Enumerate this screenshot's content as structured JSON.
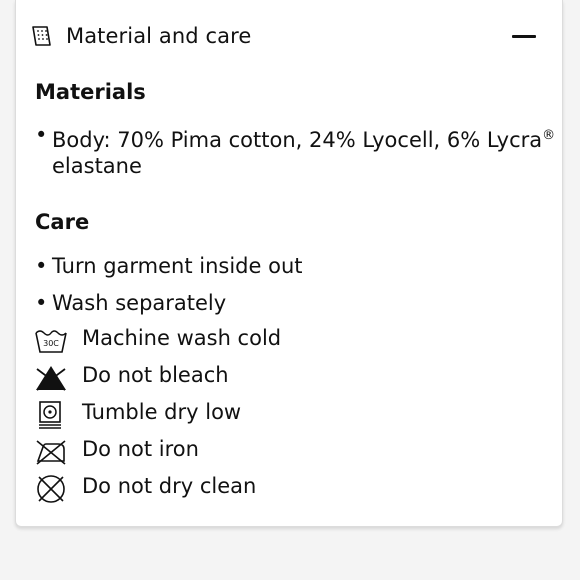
{
  "section": {
    "title": "Material and care",
    "icon": "care-label-icon"
  },
  "materials": {
    "heading": "Materials",
    "body_line1": "Body: 70% Pima cotton, 24% Lyocell, 6% Lycra",
    "registered_mark": "®",
    "body_line2": "elastane"
  },
  "care": {
    "heading": "Care",
    "bullets": [
      "Turn garment inside out",
      "Wash separately"
    ],
    "wash_symbol_text": "30C",
    "instructions": [
      {
        "icon": "wash-30-icon",
        "label": "Machine wash cold"
      },
      {
        "icon": "do-not-bleach-icon",
        "label": "Do not bleach"
      },
      {
        "icon": "tumble-dry-low-icon",
        "label": "Tumble dry low"
      },
      {
        "icon": "do-not-iron-icon",
        "label": "Do not iron"
      },
      {
        "icon": "do-not-dry-clean-icon",
        "label": "Do not dry clean"
      }
    ]
  }
}
